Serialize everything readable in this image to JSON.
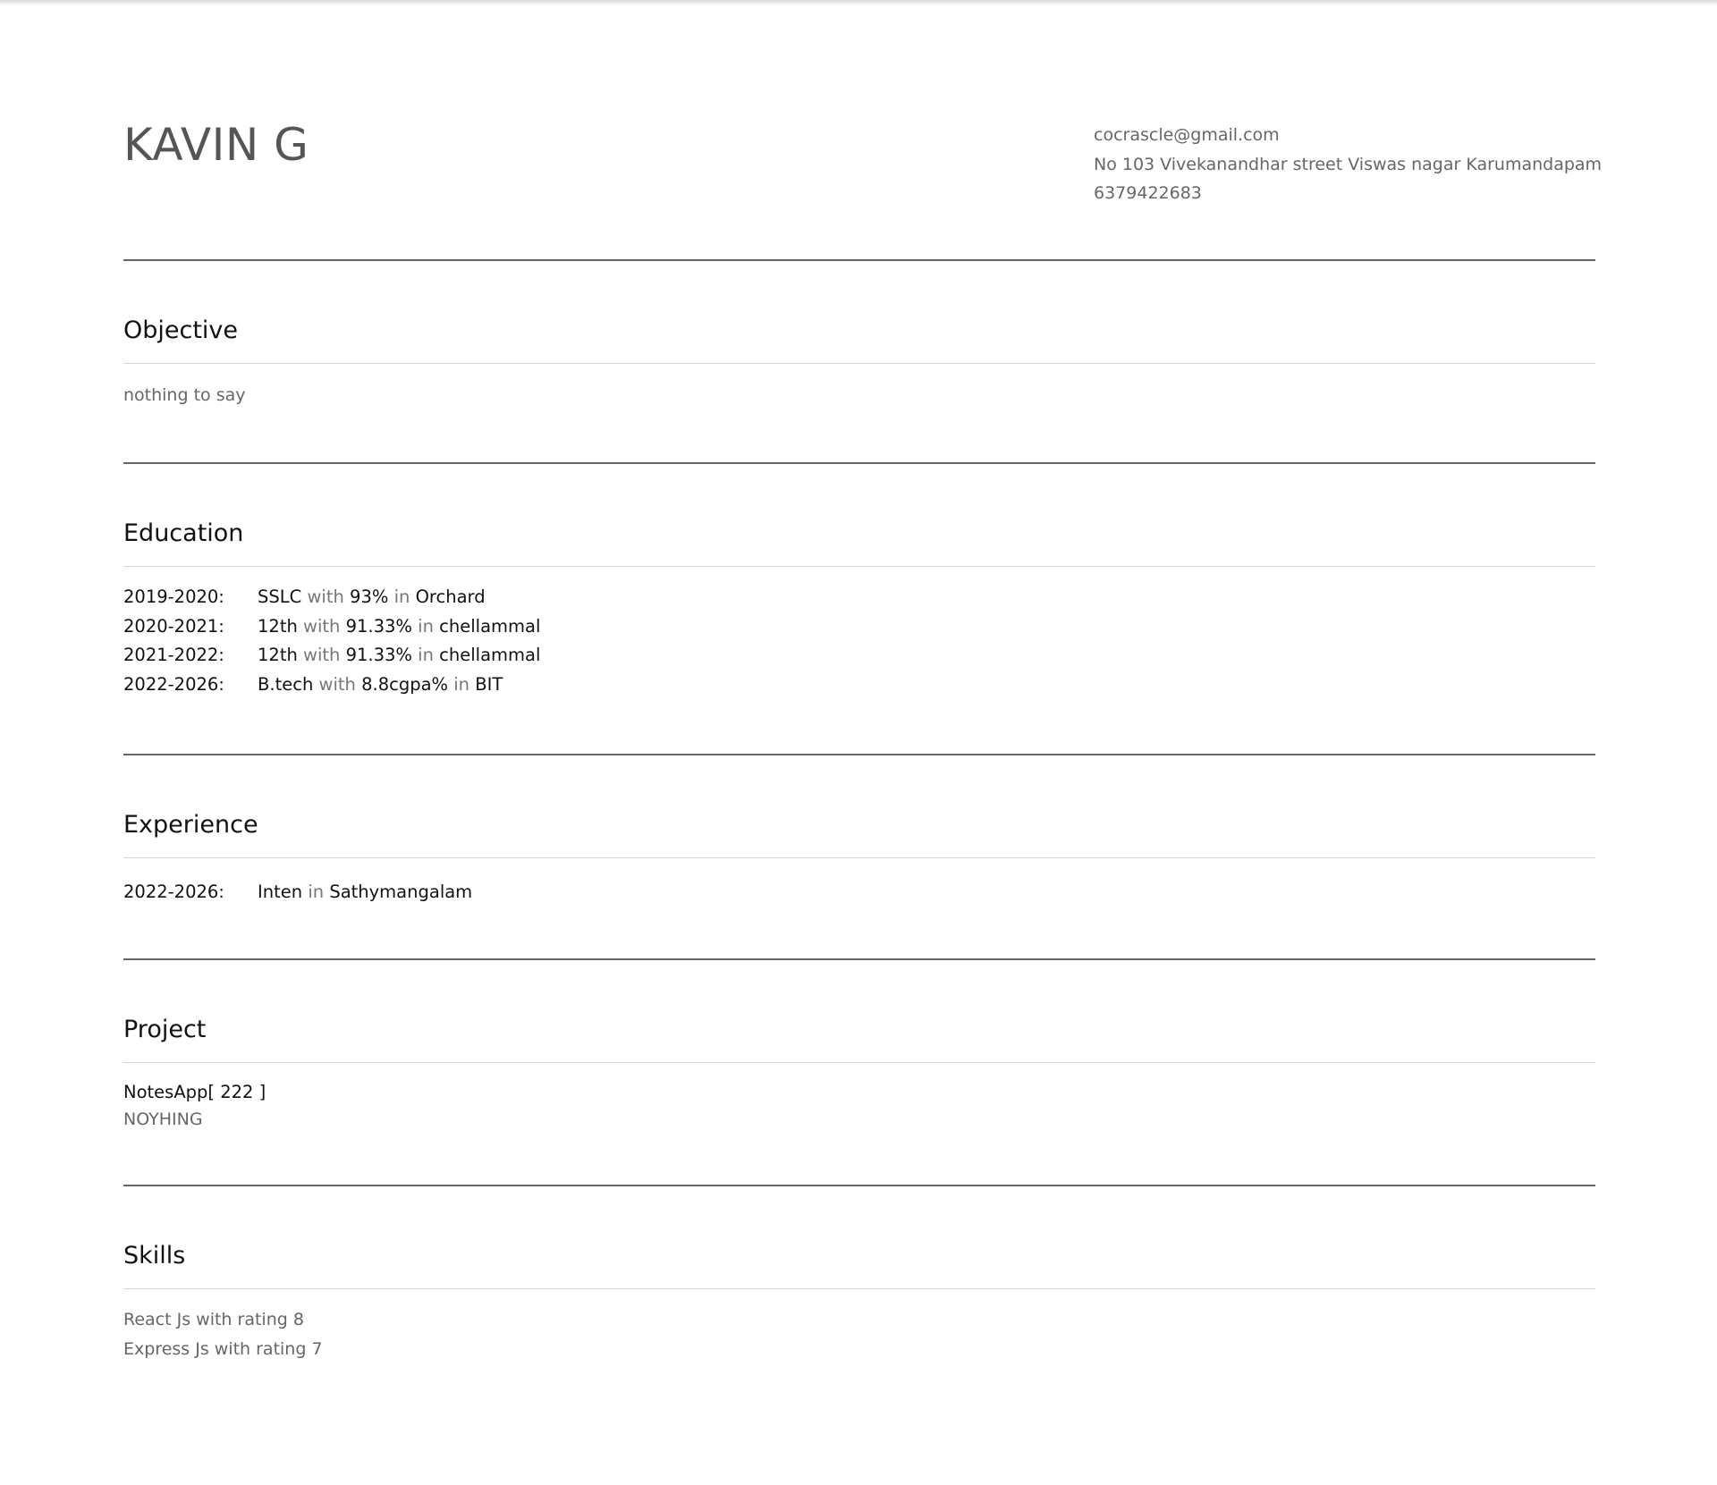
{
  "header": {
    "name": "KAVIN G",
    "email": "cocrascle@gmail.com",
    "address": "No 103 Vivekanandhar street Viswas nagar Karumandapam",
    "phone": "6379422683"
  },
  "objective": {
    "title": "Objective",
    "text": "nothing to say"
  },
  "education": {
    "title": "Education",
    "connector_with": "with",
    "connector_in": "in",
    "rows": [
      {
        "years": "2019-2020:",
        "degree": "SSLC",
        "score": "93%",
        "institution": "Orchard"
      },
      {
        "years": "2020-2021:",
        "degree": "12th",
        "score": "91.33%",
        "institution": "chellammal"
      },
      {
        "years": "2021-2022:",
        "degree": "12th",
        "score": "91.33%",
        "institution": "chellammal"
      },
      {
        "years": "2022-2026:",
        "degree": "B.tech",
        "score": "8.8cgpa%",
        "institution": "BIT"
      }
    ]
  },
  "experience": {
    "title": "Experience",
    "connector_in": "in",
    "rows": [
      {
        "years": "2022-2026:",
        "role": "Inten",
        "place": "Sathymangalam"
      }
    ]
  },
  "project": {
    "title": "Project",
    "items": [
      {
        "name": "NotesApp[ 222 ]",
        "description": "NOYHING"
      }
    ]
  },
  "skills": {
    "title": "Skills",
    "items": [
      "React Js with rating 8",
      "Express Js with rating 7"
    ]
  }
}
